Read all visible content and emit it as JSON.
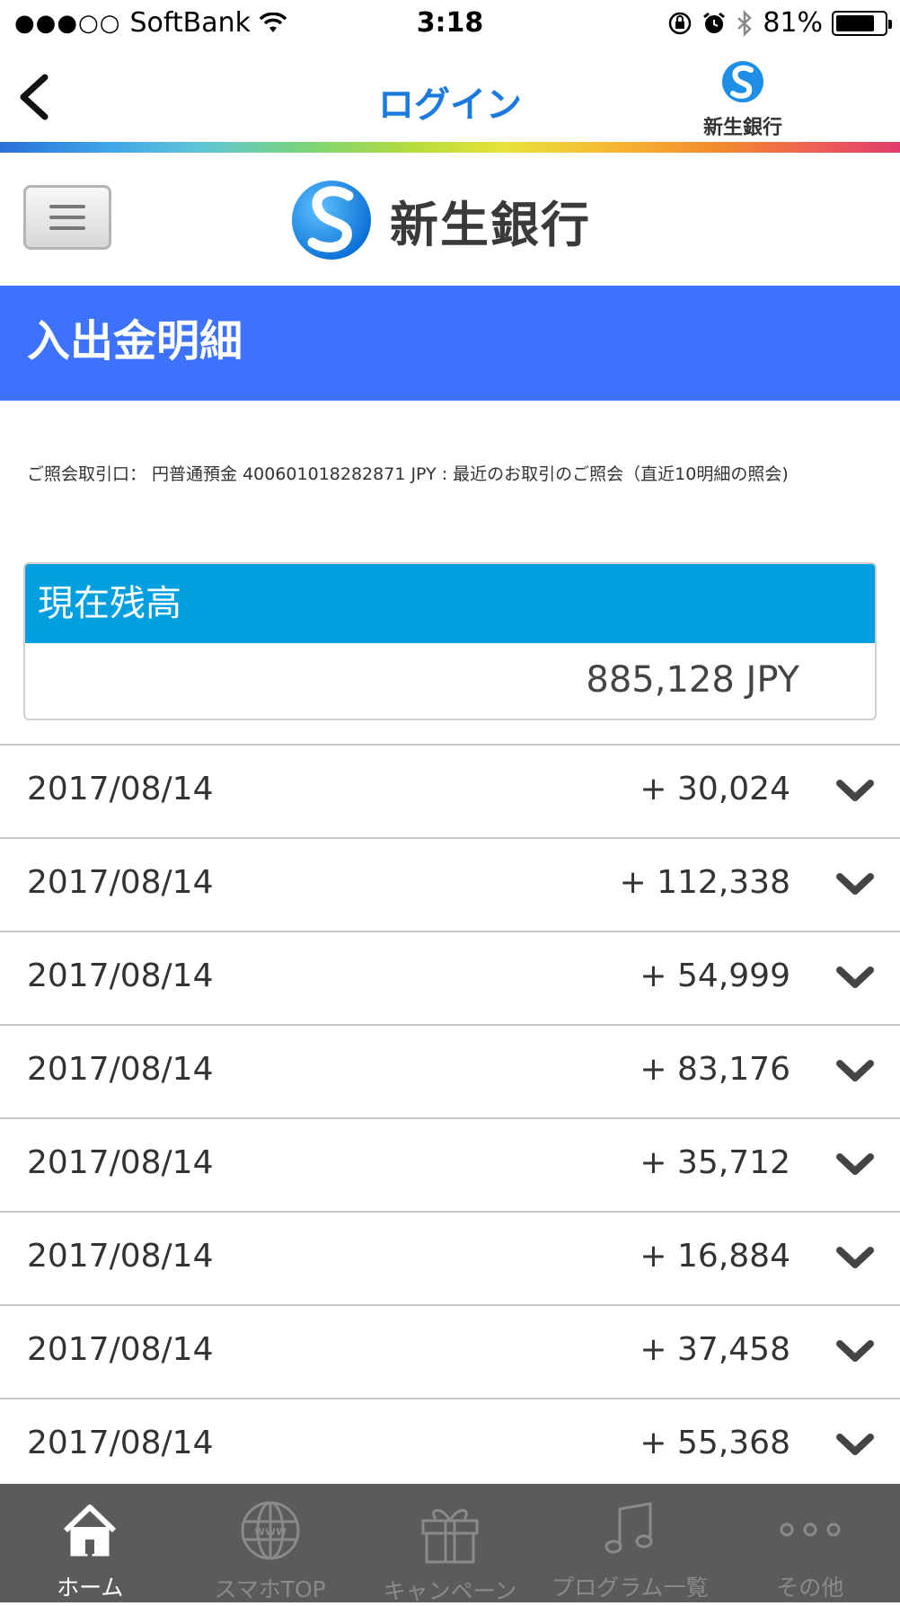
{
  "status_bar": {
    "signal": "●●●○○",
    "carrier": "SoftBank",
    "time": "3:18",
    "battery_percent": "81%",
    "battery_level": 0.81
  },
  "nav": {
    "title": "ログイン",
    "logo_text": "新生銀行"
  },
  "header": {
    "logo_text": "新生銀行"
  },
  "page": {
    "title": "入出金明細",
    "account_info": "ご照会取引口： 円普通預金 400601018282871 JPY : 最近のお取引のご照会（直近10明細の照会)"
  },
  "balance": {
    "label": "現在残高",
    "value": "885,128 JPY"
  },
  "transactions": [
    {
      "date": "2017/08/14",
      "amount": "+ 30,024"
    },
    {
      "date": "2017/08/14",
      "amount": "+ 112,338"
    },
    {
      "date": "2017/08/14",
      "amount": "+ 54,999"
    },
    {
      "date": "2017/08/14",
      "amount": "+ 83,176"
    },
    {
      "date": "2017/08/14",
      "amount": "+ 35,712"
    },
    {
      "date": "2017/08/14",
      "amount": "+ 16,884"
    },
    {
      "date": "2017/08/14",
      "amount": "+ 37,458"
    },
    {
      "date": "2017/08/14",
      "amount": "+ 55,368"
    }
  ],
  "tabs": [
    {
      "label": "ホーム",
      "icon": "home-icon",
      "active": true
    },
    {
      "label": "スマホTOP",
      "icon": "globe-icon",
      "active": false
    },
    {
      "label": "キャンペーン",
      "icon": "gift-icon",
      "active": false
    },
    {
      "label": "プログラム一覧",
      "icon": "music-note-icon",
      "active": false
    },
    {
      "label": "その他",
      "icon": "more-icon",
      "active": false
    }
  ],
  "colors": {
    "nav_title": "#1a7ae0",
    "page_title_bar": "#3d72ff",
    "balance_header": "#00a0e0",
    "tab_bar": "#5b5b5b",
    "brand_logo": "#1e8fe6"
  }
}
